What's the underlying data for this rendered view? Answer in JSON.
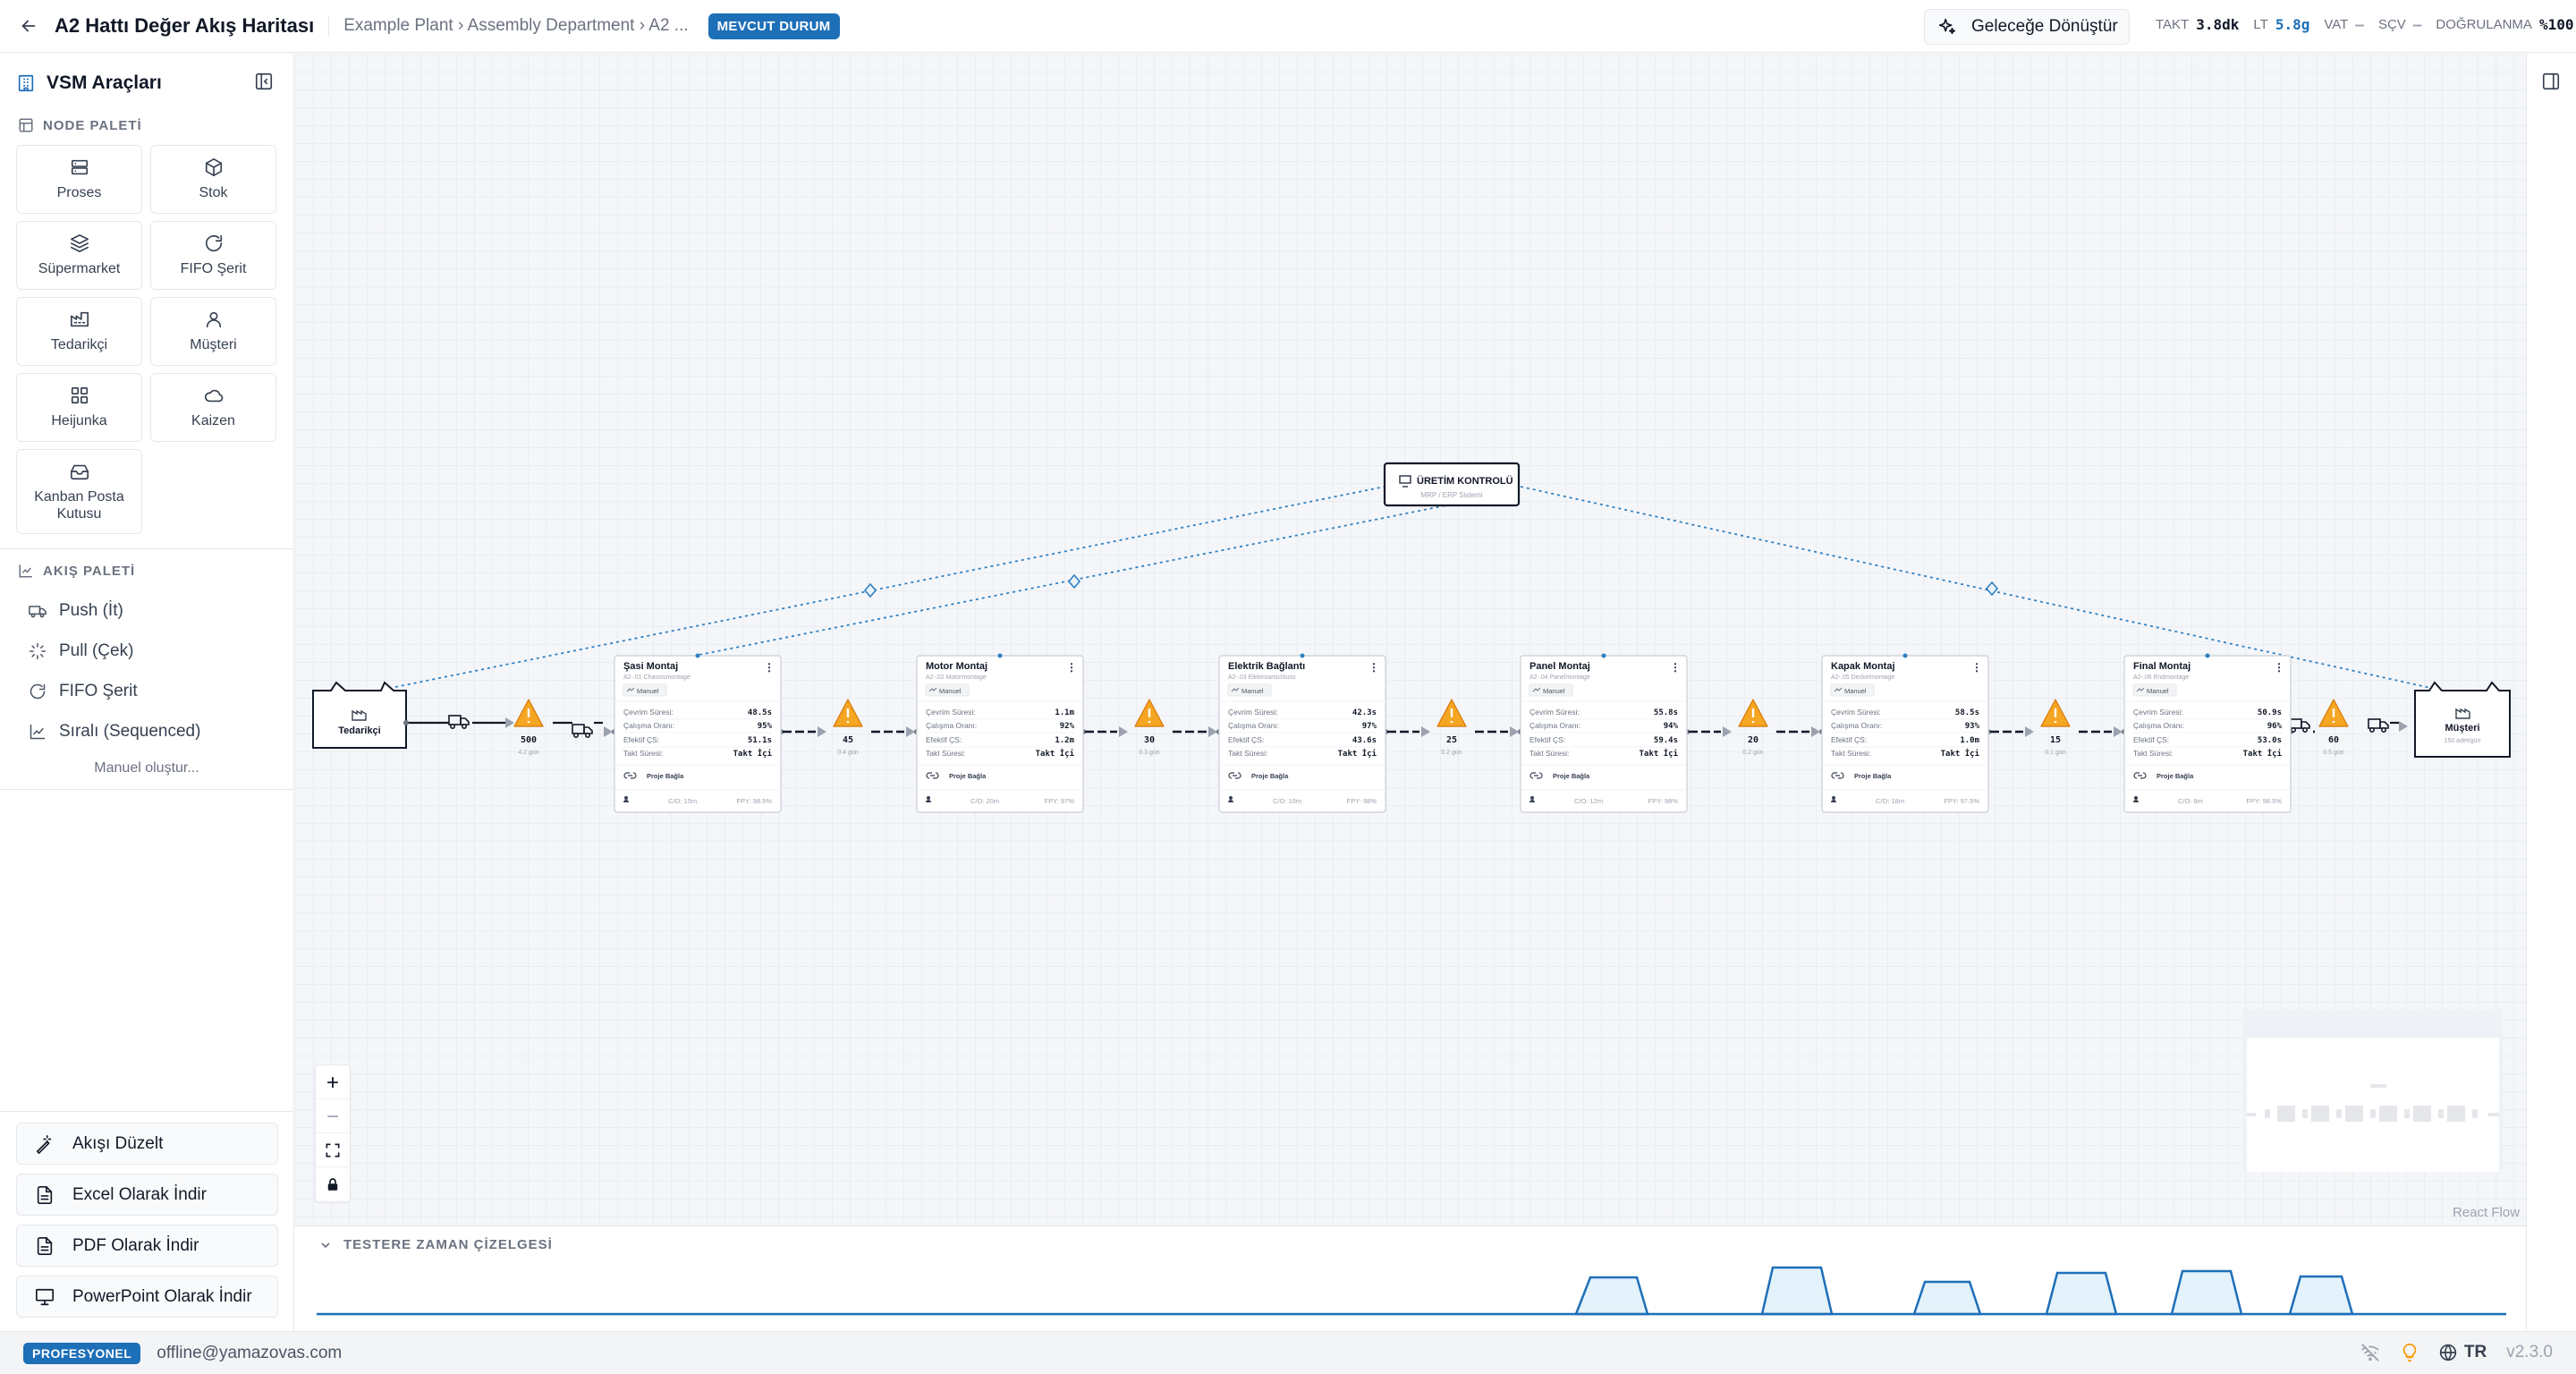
{
  "header": {
    "title": "A2 Hattı Değer Akış Haritası",
    "breadcrumb": "Example Plant › Assembly Department › A2 ...",
    "state_badge": "MEVCUT DURUM",
    "future_button": "Geleceğe Dönüştür",
    "metrics": [
      {
        "label": "TAKT",
        "value": "3.8dk",
        "color": "#111827"
      },
      {
        "label": "LT",
        "value": "5.8g",
        "color": "#1d6fb8"
      },
      {
        "label": "VAT",
        "value": "—",
        "color": "#9ca3af"
      },
      {
        "label": "SÇV",
        "value": "—",
        "color": "#9ca3af"
      },
      {
        "label": "DOĞRULANMA",
        "value": "%100",
        "color": "#111827"
      }
    ]
  },
  "sidebar": {
    "title": "VSM Araçları",
    "node_palette_label": "NODE PALETİ",
    "nodes": [
      {
        "label": "Proses",
        "icon": "server-icon"
      },
      {
        "label": "Stok",
        "icon": "box-icon"
      },
      {
        "label": "Süpermarket",
        "icon": "layers-icon"
      },
      {
        "label": "FIFO Şerit",
        "icon": "circle-arrow-icon"
      },
      {
        "label": "Tedarikçi",
        "icon": "factory-icon"
      },
      {
        "label": "Müşteri",
        "icon": "user-icon"
      },
      {
        "label": "Heijunka",
        "icon": "grid-icon"
      },
      {
        "label": "Kaizen",
        "icon": "cloud-icon"
      },
      {
        "label": "Kanban Posta Kutusu",
        "icon": "inbox-icon"
      }
    ],
    "flow_palette_label": "AKIŞ PALETİ",
    "flows": [
      {
        "label": "Push (İt)",
        "icon": "truck-icon"
      },
      {
        "label": "Pull (Çek)",
        "icon": "sparkle-icon"
      },
      {
        "label": "FIFO Şerit",
        "icon": "circle-arrow-icon"
      },
      {
        "label": "Sıralı (Sequenced)",
        "icon": "chart-line-icon"
      }
    ],
    "manual_create": "Manuel oluştur...",
    "actions": [
      {
        "label": "Akışı Düzelt",
        "icon": "wand-icon"
      },
      {
        "label": "Excel Olarak İndir",
        "icon": "file-icon"
      },
      {
        "label": "PDF Olarak İndir",
        "icon": "file-icon"
      },
      {
        "label": "PowerPoint Olarak İndir",
        "icon": "presentation-icon"
      }
    ]
  },
  "diagram": {
    "control": {
      "title": "ÜRETİM KONTROLÜ",
      "subtitle": "MRP / ERP Sistemi"
    },
    "supplier": {
      "label": "Tedarikçi"
    },
    "customer": {
      "label": "Müşteri",
      "sub": "150 adet/gün"
    },
    "inventories": [
      {
        "qty": "500",
        "days": "4.2 gün"
      },
      {
        "qty": "45",
        "days": "0.4 gün"
      },
      {
        "qty": "30",
        "days": "0.3 gün"
      },
      {
        "qty": "25",
        "days": "0.2 gün"
      },
      {
        "qty": "20",
        "days": "0.2 gün"
      },
      {
        "qty": "15",
        "days": "0.1 gün"
      },
      {
        "qty": "60",
        "days": "0.5 gün"
      }
    ],
    "process_labels": {
      "mode": "Manuel",
      "cycle": "Çevrim Süresi:",
      "uptime": "Çalışma Oranı:",
      "eff": "Efektif ÇS:",
      "takt": "Takt Süresi:",
      "takt_value": "Takt İçi",
      "project": "Proje Bağla"
    },
    "processes": [
      {
        "name": "Şasi Montaj",
        "code": "A2-.01 Chassismontage",
        "cycle": "48.5s",
        "uptime": "95%",
        "eff": "51.1s",
        "co": "C/O: 15m",
        "fpy": "FPY: 98.5%"
      },
      {
        "name": "Motor Montaj",
        "code": "A2-.02 Motormontage",
        "cycle": "1.1m",
        "uptime": "92%",
        "eff": "1.2m",
        "co": "C/O: 20m",
        "fpy": "FPY: 97%"
      },
      {
        "name": "Elektrik Bağlantı",
        "code": "A2-.03 Elektroanschluss",
        "cycle": "42.3s",
        "uptime": "97%",
        "eff": "43.6s",
        "co": "C/O: 10m",
        "fpy": "FPY: 98%"
      },
      {
        "name": "Panel Montaj",
        "code": "A2-.04 Panelmontage",
        "cycle": "55.8s",
        "uptime": "94%",
        "eff": "59.4s",
        "co": "C/O: 12m",
        "fpy": "FPY: 98%"
      },
      {
        "name": "Kapak Montaj",
        "code": "A2-.05 Deckelmontage",
        "cycle": "58.5s",
        "uptime": "93%",
        "eff": "1.0m",
        "co": "C/O: 18m",
        "fpy": "FPY: 97.5%"
      },
      {
        "name": "Final Montaj",
        "code": "A2-.06 Endmontage",
        "cycle": "50.9s",
        "uptime": "96%",
        "eff": "53.0s",
        "co": "C/O: 8m",
        "fpy": "FPY: 98.5%"
      }
    ]
  },
  "canvas": {
    "react_flow_label": "React Flow"
  },
  "timeline": {
    "title": "TESTERE ZAMAN ÇİZELGESİ"
  },
  "footer": {
    "plan": "PROFESYONEL",
    "email": "offline@yamazovas.com",
    "lang": "TR",
    "version": "v2.3.0"
  }
}
